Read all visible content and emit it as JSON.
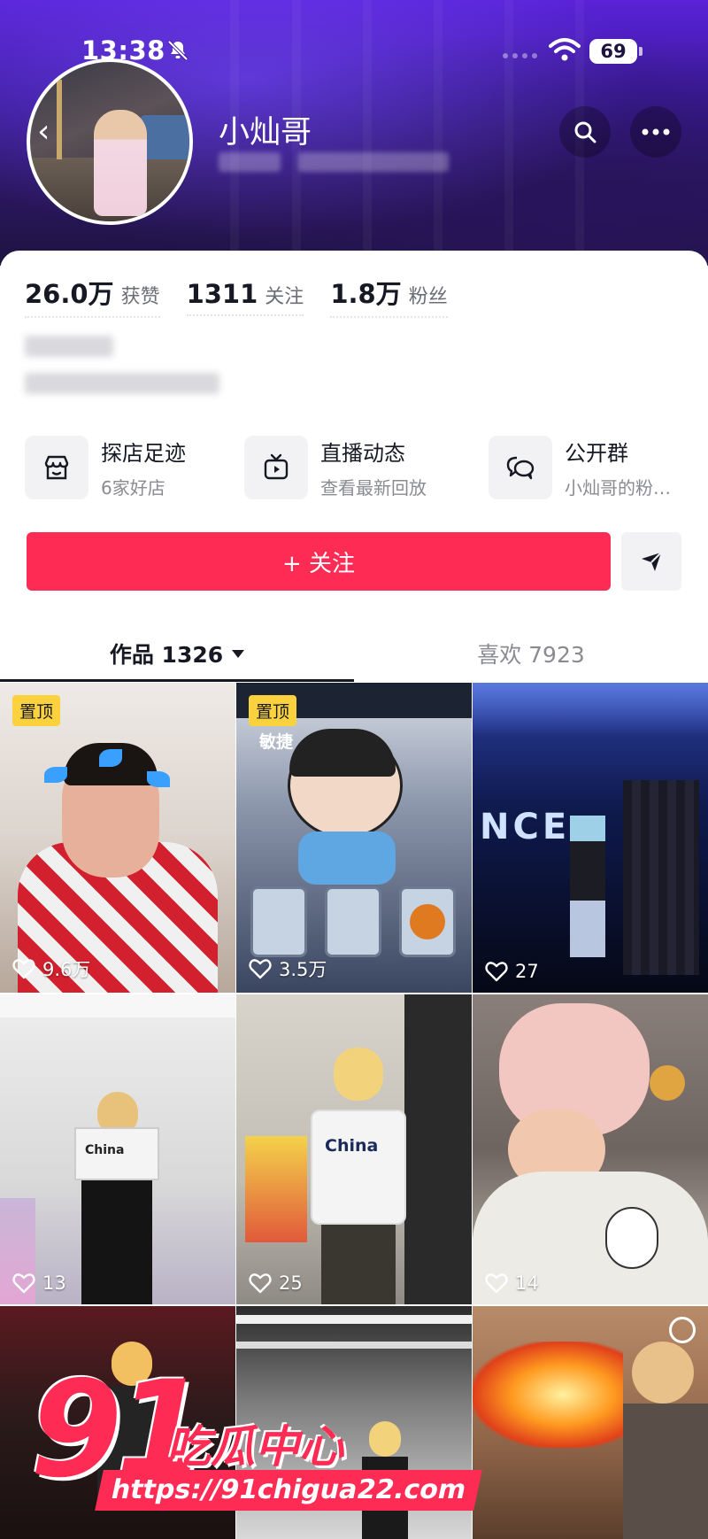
{
  "status_bar": {
    "time": "13:38",
    "battery": "69"
  },
  "profile": {
    "name": "小灿哥"
  },
  "stats": [
    {
      "value": "26.0万",
      "label": "获赞"
    },
    {
      "value": "1311",
      "label": "关注"
    },
    {
      "value": "1.8万",
      "label": "粉丝"
    }
  ],
  "features": [
    {
      "title": "探店足迹",
      "subtitle": "6家好店",
      "icon": "store-icon"
    },
    {
      "title": "直播动态",
      "subtitle": "查看最新回放",
      "icon": "tv-icon"
    },
    {
      "title": "公开群",
      "subtitle": "小灿哥的粉…",
      "icon": "chat-group-icon"
    }
  ],
  "follow_label": "+ 关注",
  "tabs": {
    "works_label": "作品 1326",
    "likes_label": "喜欢 7923"
  },
  "pin_label": "置顶",
  "sticker_text": "敏捷",
  "videos": [
    {
      "likes": "9.6万",
      "pinned": true
    },
    {
      "likes": "3.5万",
      "pinned": true
    },
    {
      "likes": "27",
      "pinned": false
    },
    {
      "likes": "13",
      "pinned": false
    },
    {
      "likes": "25",
      "pinned": false
    },
    {
      "likes": "14",
      "pinned": false
    },
    {
      "likes": "",
      "pinned": false
    },
    {
      "likes": "",
      "pinned": false
    },
    {
      "likes": "",
      "pinned": false
    }
  ],
  "video_texts": {
    "dance_sign": "NCE",
    "shirt_text": "China"
  },
  "watermark": {
    "brand": "91",
    "name": "吃瓜中心",
    "url": "https://91chigua22.com"
  },
  "colors": {
    "accent": "#fe2c55",
    "pin_badge": "#fbd23d",
    "header": "#3d1a9e"
  }
}
